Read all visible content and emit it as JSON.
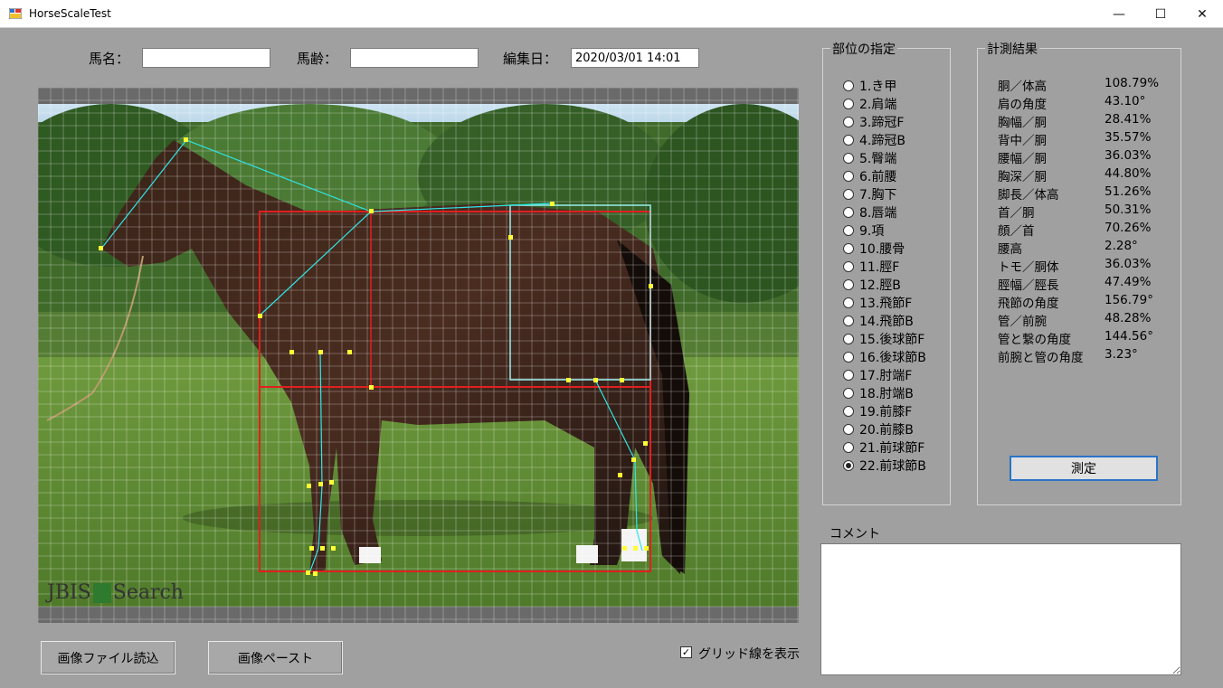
{
  "window": {
    "title": "HorseScaleTest",
    "minimize": "—",
    "maximize": "☐",
    "close": "✕"
  },
  "form": {
    "name_label": "馬名：",
    "name_value": "",
    "age_label": "馬齢：",
    "age_value": "",
    "date_label": "編集日：",
    "date_value": "2020/03/01 14:01"
  },
  "watermark": {
    "left": "JBIS",
    "right": "Search"
  },
  "parts": {
    "title": "部位の指定",
    "items": [
      "1.き甲",
      "2.肩端",
      "3.蹄冠F",
      "4.蹄冠B",
      "5.臀端",
      "6.前腰",
      "7.胸下",
      "8.唇端",
      "9.項",
      "10.腰骨",
      "11.脛F",
      "12.脛B",
      "13.飛節F",
      "14.飛節B",
      "15.後球節F",
      "16.後球節B",
      "17.肘端F",
      "18.肘端B",
      "19.前膝F",
      "20.前膝B",
      "21.前球節F",
      "22.前球節B"
    ],
    "selected_index": 21
  },
  "results": {
    "title": "計測結果",
    "rows": [
      {
        "k": "胴／体高",
        "v": "108.79%"
      },
      {
        "k": "肩の角度",
        "v": "43.10°"
      },
      {
        "k": "胸幅／胴",
        "v": "28.41%"
      },
      {
        "k": "背中／胴",
        "v": "35.57%"
      },
      {
        "k": "腰幅／胴",
        "v": "36.03%"
      },
      {
        "k": "胸深／胴",
        "v": "44.80%"
      },
      {
        "k": "脚長／体高",
        "v": "51.26%"
      },
      {
        "k": "首／胴",
        "v": "50.31%"
      },
      {
        "k": "顔／首",
        "v": "70.26%"
      },
      {
        "k": "腰高",
        "v": "2.28°"
      },
      {
        "k": "トモ／胴体",
        "v": "36.03%"
      },
      {
        "k": "脛幅／脛長",
        "v": "47.49%"
      },
      {
        "k": "飛節の角度",
        "v": "156.79°"
      },
      {
        "k": "管／前腕",
        "v": "48.28%"
      },
      {
        "k": "管と繋の角度",
        "v": "144.56°"
      },
      {
        "k": "前腕と管の角度",
        "v": "3.23°"
      }
    ],
    "measure_button": "測定"
  },
  "comment": {
    "label": "コメント",
    "value": ""
  },
  "buttons": {
    "load_image": "画像ファイル読込",
    "paste_image": "画像ペースト"
  },
  "grid_toggle": {
    "label": "グリッド線を表示",
    "checked": true
  },
  "colors": {
    "accent": "#2a73c8",
    "overlay_line": "#2ee6e6",
    "box_line": "#e02020",
    "point": "#ffff33"
  }
}
